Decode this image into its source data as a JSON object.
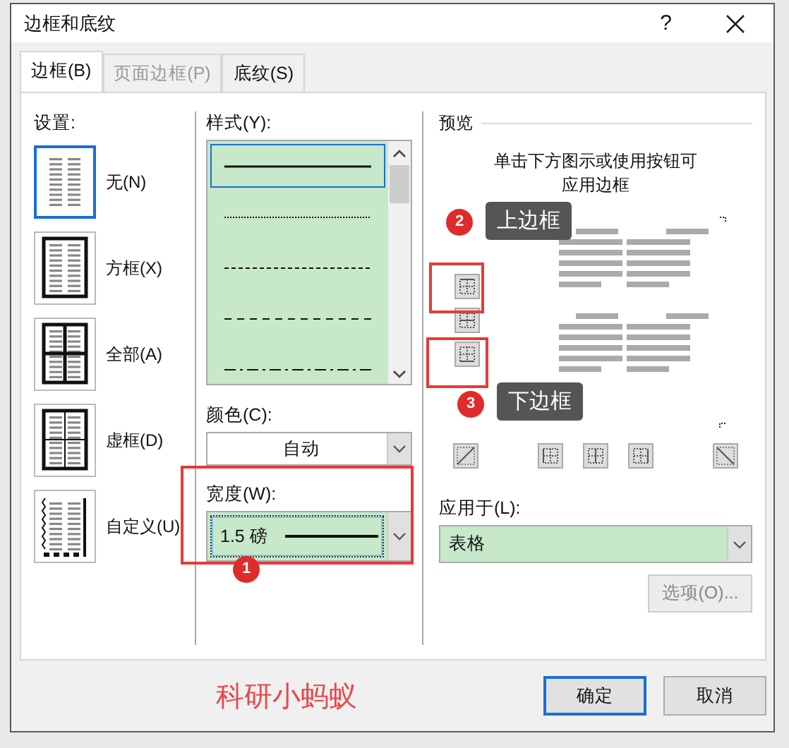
{
  "window": {
    "title": "边框和底纹",
    "help": "?"
  },
  "tabs": [
    {
      "label": "边框(B)",
      "selected": true,
      "disabled": false
    },
    {
      "label": "页面边框(P)",
      "selected": false,
      "disabled": true
    },
    {
      "label": "底纹(S)",
      "selected": false,
      "disabled": false
    }
  ],
  "settings": {
    "label": "设置:",
    "items": [
      {
        "label": "无(N)",
        "kind": "none",
        "selected": true
      },
      {
        "label": "方框(X)",
        "kind": "box",
        "selected": false
      },
      {
        "label": "全部(A)",
        "kind": "all",
        "selected": false
      },
      {
        "label": "虚框(D)",
        "kind": "grid",
        "selected": false
      },
      {
        "label": "自定义(U)",
        "kind": "custom",
        "selected": false
      }
    ]
  },
  "style": {
    "label": "样式(Y):",
    "items": [
      {
        "kind": "solid",
        "selected": true
      },
      {
        "kind": "dotted",
        "selected": false
      },
      {
        "kind": "fine-dashed",
        "selected": false
      },
      {
        "kind": "dashed",
        "selected": false
      },
      {
        "kind": "dash-dot",
        "selected": false
      }
    ]
  },
  "color": {
    "label": "颜色(C):",
    "value": "自动"
  },
  "width": {
    "label": "宽度(W):",
    "value": "1.5 磅"
  },
  "preview": {
    "label": "预览",
    "hint": "单击下方图示或使用按钮可应用边框"
  },
  "apply_to": {
    "label": "应用于(L):",
    "value": "表格"
  },
  "options_button": {
    "label": "选项(O)...",
    "disabled": true
  },
  "buttons": [
    {
      "label": "确定",
      "default": true
    },
    {
      "label": "取消",
      "default": false
    }
  ],
  "annotations": {
    "brand": "科研小蚂蚁",
    "markers": [
      {
        "number": "1"
      },
      {
        "number": "2",
        "callout": "上边框"
      },
      {
        "number": "3",
        "callout": "下边框"
      }
    ]
  }
}
